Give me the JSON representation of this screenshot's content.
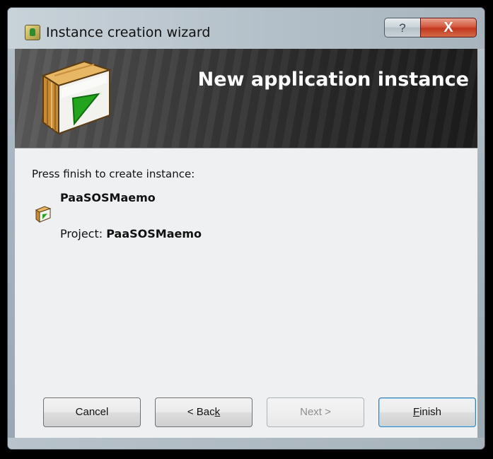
{
  "window": {
    "title": "Instance creation wizard",
    "help_label": "?",
    "close_label": "X"
  },
  "banner": {
    "title": "New application instance",
    "logo_icon": "application-package-icon"
  },
  "content": {
    "prompt": "Press finish to create instance:",
    "instance_name": "PaaSOSMaemo",
    "instance_icon": "application-package-icon",
    "project_label": "Project:",
    "project_value": "PaaSOSMaemo"
  },
  "buttons": {
    "cancel": "Cancel",
    "back_prefix": "< Bac",
    "back_mnemonic": "k",
    "next": "Next >",
    "next_enabled": false,
    "finish_mnemonic": "F",
    "finish_rest": "inish"
  },
  "colors": {
    "banner_text": "#ffffff",
    "close_button": "#c2381f",
    "package_green": "#22a51c",
    "package_wood": "#d9a24a"
  }
}
